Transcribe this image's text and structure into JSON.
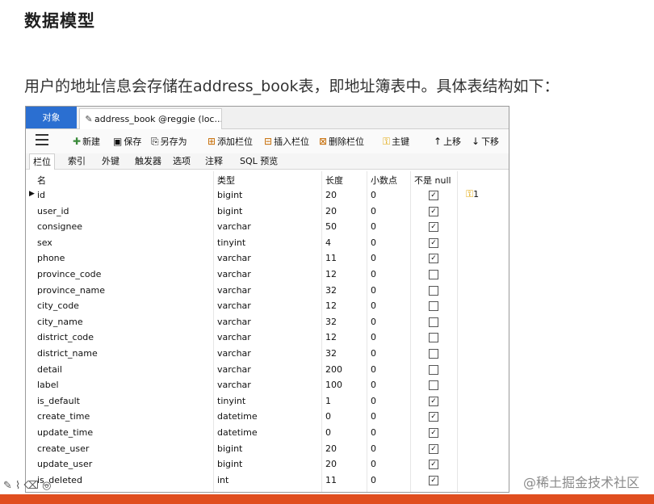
{
  "heading": "数据模型",
  "intro": "用户的地址信息会存储在address_book表，即地址簿表中。具体表结构如下：",
  "tool": {
    "tab_objects": "对象",
    "tab_file": "address_book @reggie (loc...",
    "toolbar": {
      "new": "新建",
      "save": "保存",
      "save_as": "另存为",
      "add_column": "添加栏位",
      "insert_column": "插入栏位",
      "delete_column": "删除栏位",
      "primary_key": "主键",
      "move_up": "上移",
      "move_down": "下移"
    },
    "subtabs": [
      "栏位",
      "索引",
      "外键",
      "触发器",
      "选项",
      "注释",
      "SQL 预览"
    ],
    "columns": {
      "name": "名",
      "type": "类型",
      "length": "长度",
      "decimals": "小数点",
      "not_null": "不是 null"
    },
    "rows": [
      {
        "name": "id",
        "type": "bigint",
        "length": "20",
        "decimals": "0",
        "not_null": true,
        "key": "1"
      },
      {
        "name": "user_id",
        "type": "bigint",
        "length": "20",
        "decimals": "0",
        "not_null": true,
        "key": ""
      },
      {
        "name": "consignee",
        "type": "varchar",
        "length": "50",
        "decimals": "0",
        "not_null": true,
        "key": ""
      },
      {
        "name": "sex",
        "type": "tinyint",
        "length": "4",
        "decimals": "0",
        "not_null": true,
        "key": ""
      },
      {
        "name": "phone",
        "type": "varchar",
        "length": "11",
        "decimals": "0",
        "not_null": true,
        "key": ""
      },
      {
        "name": "province_code",
        "type": "varchar",
        "length": "12",
        "decimals": "0",
        "not_null": false,
        "key": ""
      },
      {
        "name": "province_name",
        "type": "varchar",
        "length": "32",
        "decimals": "0",
        "not_null": false,
        "key": ""
      },
      {
        "name": "city_code",
        "type": "varchar",
        "length": "12",
        "decimals": "0",
        "not_null": false,
        "key": ""
      },
      {
        "name": "city_name",
        "type": "varchar",
        "length": "32",
        "decimals": "0",
        "not_null": false,
        "key": ""
      },
      {
        "name": "district_code",
        "type": "varchar",
        "length": "12",
        "decimals": "0",
        "not_null": false,
        "key": ""
      },
      {
        "name": "district_name",
        "type": "varchar",
        "length": "32",
        "decimals": "0",
        "not_null": false,
        "key": ""
      },
      {
        "name": "detail",
        "type": "varchar",
        "length": "200",
        "decimals": "0",
        "not_null": false,
        "key": ""
      },
      {
        "name": "label",
        "type": "varchar",
        "length": "100",
        "decimals": "0",
        "not_null": false,
        "key": ""
      },
      {
        "name": "is_default",
        "type": "tinyint",
        "length": "1",
        "decimals": "0",
        "not_null": true,
        "key": ""
      },
      {
        "name": "create_time",
        "type": "datetime",
        "length": "0",
        "decimals": "0",
        "not_null": true,
        "key": ""
      },
      {
        "name": "update_time",
        "type": "datetime",
        "length": "0",
        "decimals": "0",
        "not_null": true,
        "key": ""
      },
      {
        "name": "create_user",
        "type": "bigint",
        "length": "20",
        "decimals": "0",
        "not_null": true,
        "key": ""
      },
      {
        "name": "update_user",
        "type": "bigint",
        "length": "20",
        "decimals": "0",
        "not_null": true,
        "key": ""
      },
      {
        "name": "is_deleted",
        "type": "int",
        "length": "11",
        "decimals": "0",
        "not_null": true,
        "key": ""
      }
    ]
  },
  "watermark": "@稀土掘金技术社区",
  "colors": {
    "accent": "#2b6fd1",
    "bottom_bar": "#e04e1f",
    "key": "#e0a400"
  }
}
